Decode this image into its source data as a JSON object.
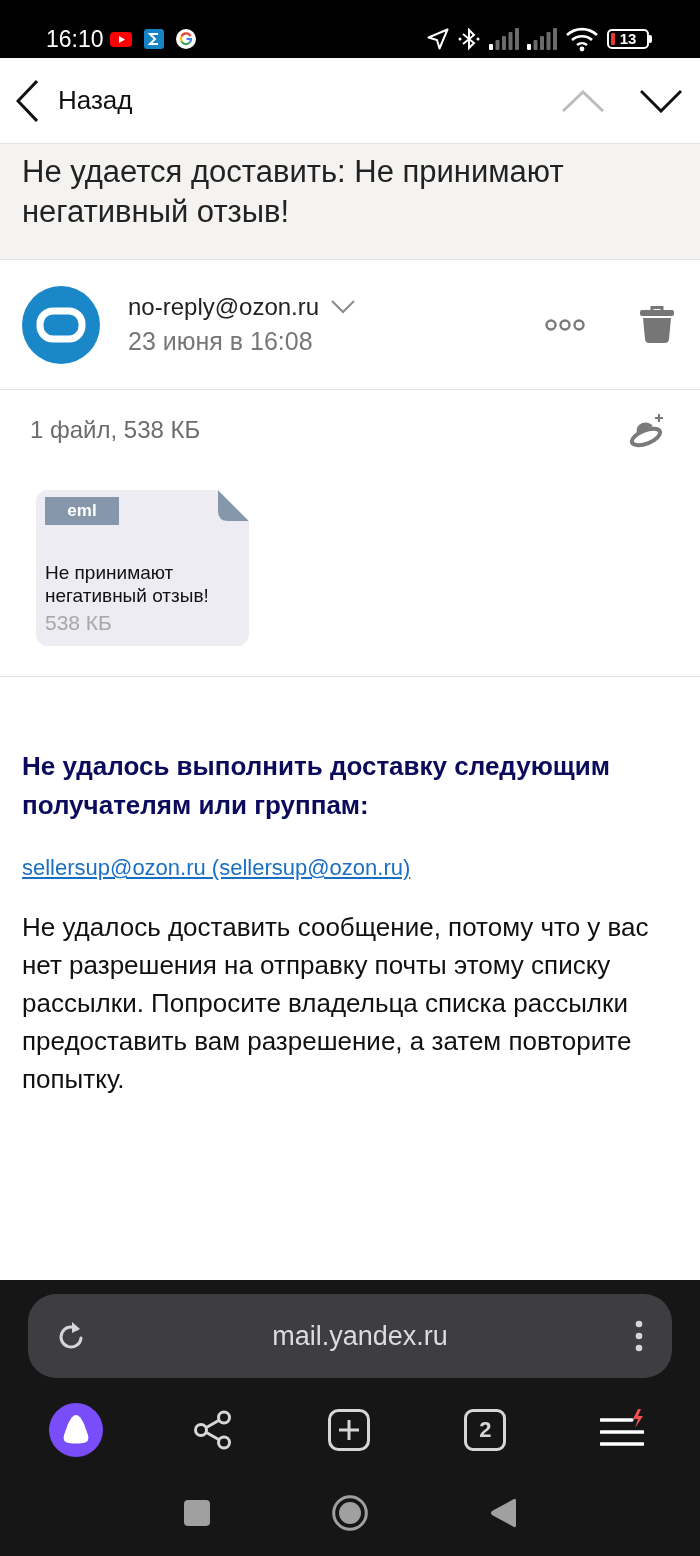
{
  "status_bar": {
    "time": "16:10",
    "battery": "13"
  },
  "header": {
    "back_label": "Назад",
    "nav_buttons": [
      {
        "kind": "previous",
        "disabled": true
      },
      {
        "kind": "next",
        "disabled": false
      }
    ]
  },
  "subject": "Не удается доставить: Не принимают негативный отзыв!",
  "sender": {
    "email": "no-reply@ozon.ru",
    "date": "23 июня в 16:08"
  },
  "attachments": {
    "summary": "1 файл, 538 КБ",
    "files": [
      {
        "type": "eml",
        "name": "Не принимают негативный отзыв!",
        "size": "538 КБ"
      }
    ]
  },
  "body": {
    "heading": "Не удалось выполнить доставку следующим получателям или группам:",
    "recipient_link": "sellersup@ozon.ru (sellersup@ozon.ru)",
    "message": "Не удалось доставить сообщение, потому что у вас нет разрешения на отправку почты этому списку рассылки. Попросите владельца списка рассылки предоставить вам разрешение, а затем повторите попытку."
  },
  "browser": {
    "url": "mail.yandex.ru",
    "tab_count": "2"
  }
}
